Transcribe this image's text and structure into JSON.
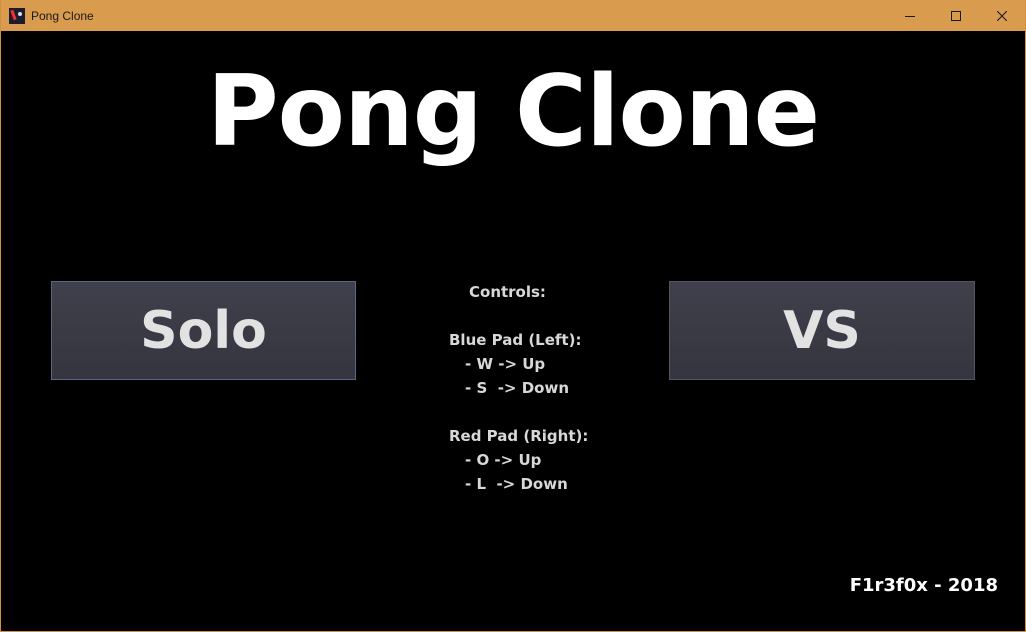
{
  "window": {
    "title": "Pong Clone",
    "icon": "pong-app-icon",
    "controls": {
      "minimize_icon": "minimize-icon",
      "maximize_icon": "maximize-icon",
      "close_icon": "close-icon"
    },
    "accent_color": "#d99b4e"
  },
  "game": {
    "title": "Pong Clone",
    "solo_label": "Solo",
    "vs_label": "VS",
    "controls": {
      "heading": "Controls:",
      "blue_heading": "Blue Pad (Left):",
      "blue_up": "- W -> Up",
      "blue_down": "- S  -> Down",
      "red_heading": "Red Pad (Right):",
      "red_up": "- O -> Up",
      "red_down": "- L  -> Down"
    },
    "credit": "F1r3f0x - 2018",
    "colors": {
      "background": "#000000",
      "button": "#3a3a45",
      "text": "#ffffff"
    }
  }
}
